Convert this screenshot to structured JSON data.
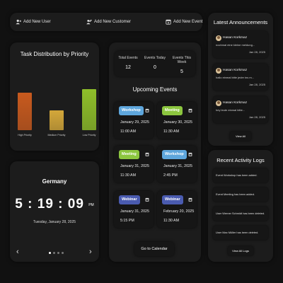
{
  "quick_actions": [
    {
      "label": "Add New User",
      "icon": "user-plus-icon"
    },
    {
      "label": "Add New Customer",
      "icon": "users-plus-icon"
    },
    {
      "label": "Add New Event",
      "icon": "calendar-plus-icon"
    }
  ],
  "chart_data": {
    "type": "bar",
    "title": "Task Distribution by Priority",
    "categories": [
      "High Priority",
      "Medium Priority",
      "Low Priority"
    ],
    "values": [
      44,
      23,
      48
    ],
    "ylim": [
      0,
      100
    ],
    "colors": [
      "#c85a1e",
      "#d4a83a",
      "#8fbf2a"
    ],
    "grid": false
  },
  "clock": {
    "location": "Germany",
    "hours": "5",
    "minutes": "19",
    "seconds": "09",
    "ampm": "PM",
    "date": "Tuesday, January 28, 2025"
  },
  "stats": [
    {
      "label": "Total Events",
      "value": "12"
    },
    {
      "label": "Events Today",
      "value": "0"
    },
    {
      "label": "Events This Week",
      "value": "5"
    }
  ],
  "upcoming": {
    "title": "Upcoming Events",
    "button": "Go to Calendar",
    "events": [
      {
        "type": "Workshop",
        "date": "January 29, 2025",
        "time": "11:00 AM"
      },
      {
        "type": "Meeting",
        "date": "January 30, 2025",
        "time": "11:30 AM"
      },
      {
        "type": "Meeting",
        "date": "January 31, 2025",
        "time": "11:30 AM"
      },
      {
        "type": "Workshop",
        "date": "January 31, 2025",
        "time": "2:45 PM"
      },
      {
        "type": "Webinar",
        "date": "January 31, 2025",
        "time": "5:15 PM"
      },
      {
        "type": "Webinar",
        "date": "February 20, 2025",
        "time": "11:30 AM"
      }
    ]
  },
  "announcements": {
    "title": "Latest Announcements",
    "view_all": "View All",
    "items": [
      {
        "author": "Hasan Korkmaz",
        "text": "nochmal eine kleine meldung...",
        "date": "Jan 28, 2025"
      },
      {
        "author": "Hasan Korkmaz",
        "text": "hallo einmal bitte jeder ins m...",
        "date": "Jan 28, 2025"
      },
      {
        "author": "Hasan Korkmaz",
        "text": "hey leute einmal bitte...",
        "date": "Jan 28, 2025"
      }
    ]
  },
  "activity": {
    "title": "Recent Activity Logs",
    "view_all": "View All Logs",
    "items": [
      "Event Workshop has been added.",
      "Event Meeting has been added.",
      "User Werner Schmidt has been deleted.",
      "User Max Müller has been deleted."
    ]
  }
}
